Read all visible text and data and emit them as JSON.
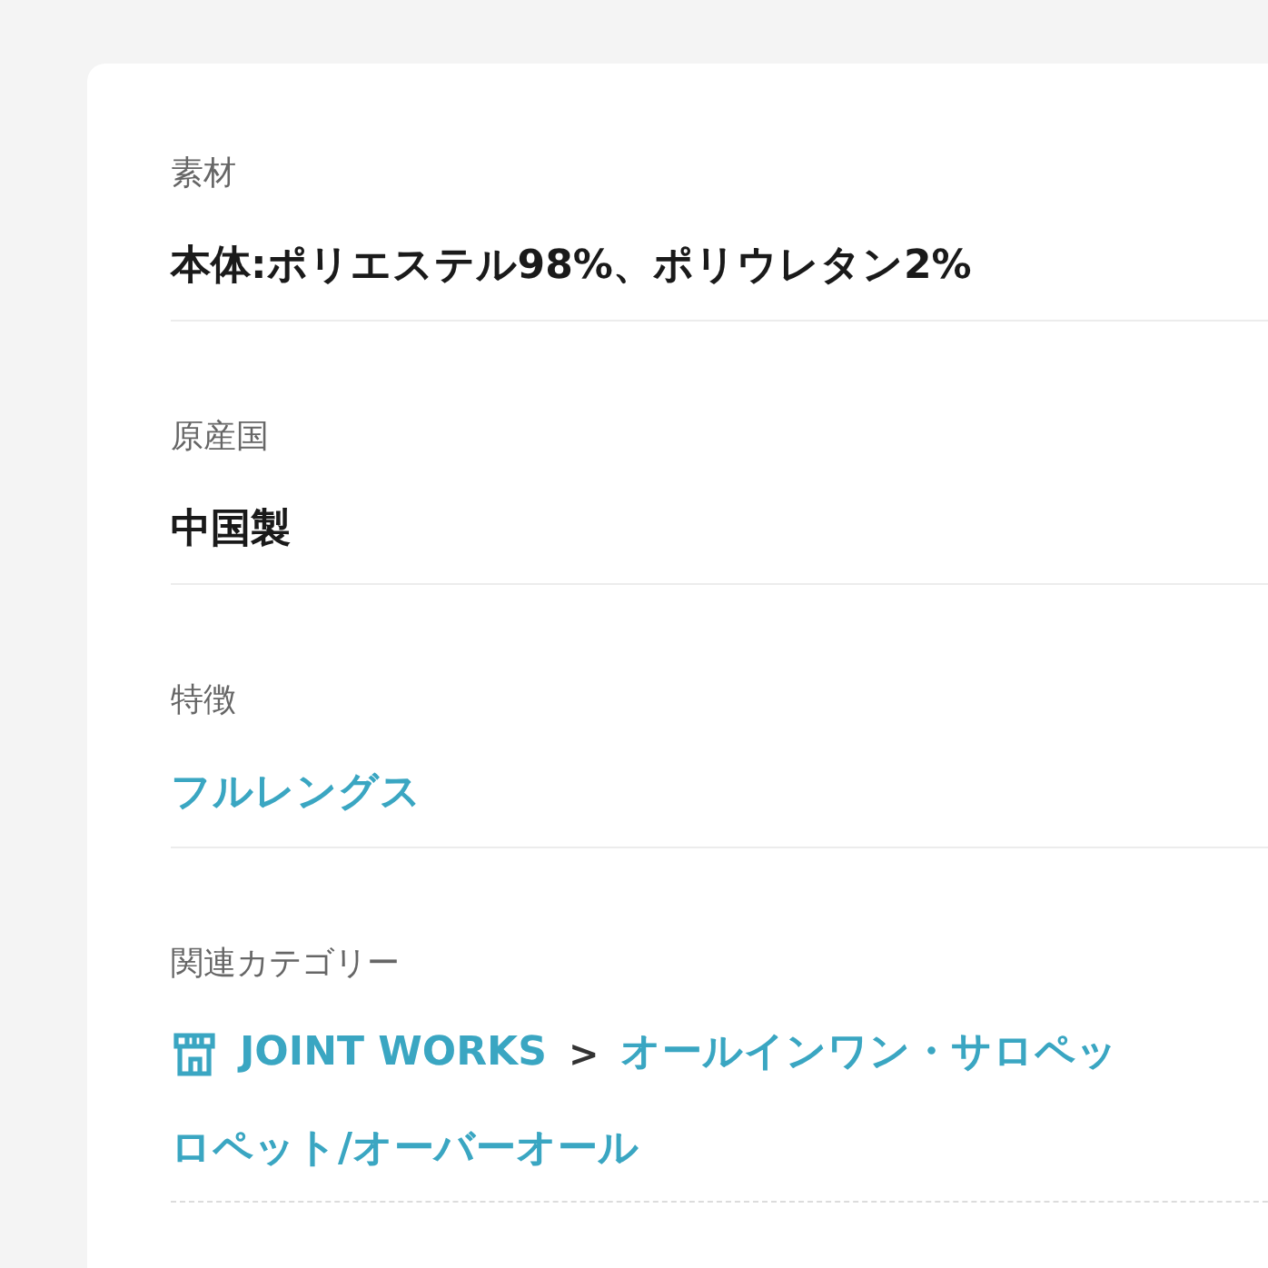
{
  "sections": [
    {
      "kind": "text",
      "label": "素材",
      "value": "本体:ポリエステル98%、ポリウレタン2%"
    },
    {
      "kind": "text",
      "label": "原産国",
      "value": "中国製"
    },
    {
      "kind": "link",
      "label": "特徴",
      "value": "フルレングス"
    },
    {
      "kind": "breadcrumb",
      "label": "関連カテゴリー",
      "shop": "JOINT WORKS",
      "separator": ">",
      "items": [
        "オールインワン・サロペッ",
        "ロペット/オーバーオール"
      ]
    }
  ]
}
